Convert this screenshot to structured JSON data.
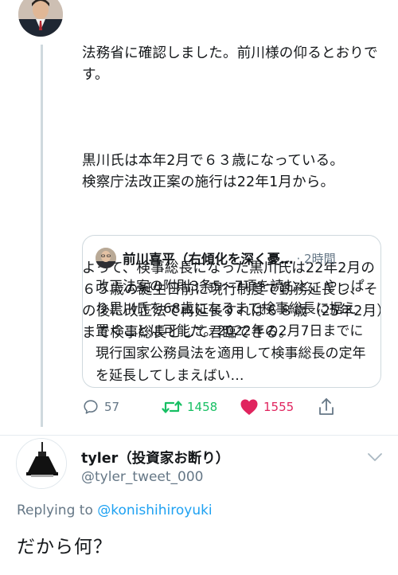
{
  "main_tweet": {
    "paragraphs": [
      "法務省に確認しました。前川様の仰るとおりです。",
      "黒川氏は本年2月で６３歳になっている。\n検察庁法改正案の施行は22年1月から。",
      "よって、検事総長になった黒川氏は22年2月の６５歳の誕生日前に現行制度で勤務延長し、その後に改正法で再延長すれば６８歳（25年2月）まで検事総長として君臨できる。"
    ]
  },
  "quote_tweet": {
    "author": "前川喜平（右傾化を深く憂…",
    "time": "· 2時間",
    "text": "改正法案の附則3条5〜7項を読むと、やっぱり黒川氏を68歳になるまで検事総長に据え置くことは可能だ。2022年の2月7日までに現行国家公務員法を適用して検事総長の定年を延長してしまえばい…"
  },
  "actions": {
    "reply_count": "57",
    "retweet_count": "1458",
    "like_count": "1555"
  },
  "reply_tweet": {
    "display_name": "tyler（投資家お断り）",
    "handle": "@tyler_tweet_000",
    "replying_prefix": "Replying to ",
    "replying_to": "@konishihiroyuki",
    "text": "だから何？"
  },
  "colors": {
    "accent": "#1da1f2",
    "retweet": "#17bf63",
    "like": "#e0245e",
    "muted": "#657786"
  }
}
